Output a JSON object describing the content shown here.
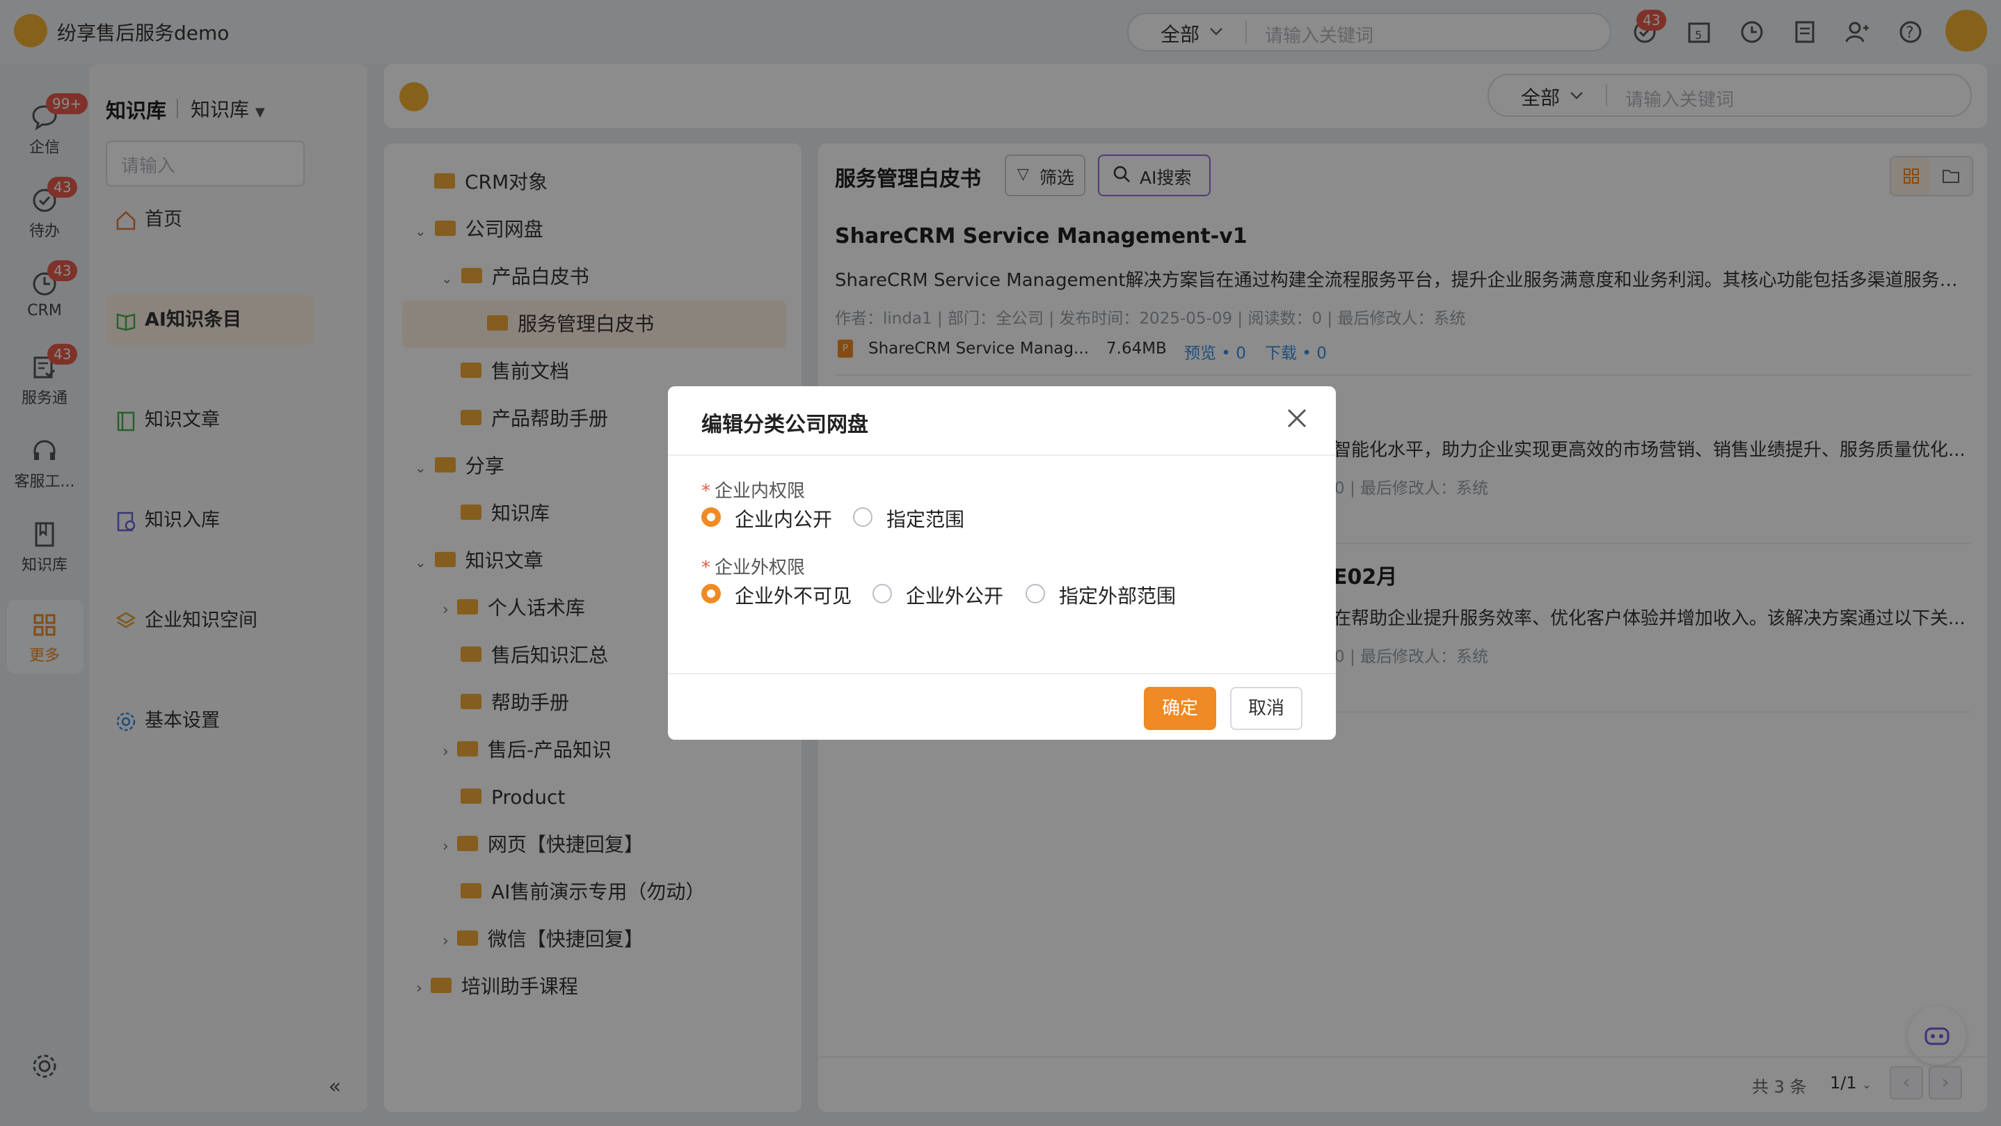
{
  "app": {
    "title": "纷享售后服务demo"
  },
  "topbar": {
    "scope": "全部",
    "search_placeholder": "请输入关键词",
    "notify_badge": "43"
  },
  "rail": [
    {
      "label": "企信",
      "badge": "99+",
      "icon": "chat-icon"
    },
    {
      "label": "待办",
      "badge": "43",
      "icon": "todo-check-icon"
    },
    {
      "label": "CRM",
      "badge": "43",
      "icon": "crm-icon"
    },
    {
      "label": "服务通",
      "badge": "43",
      "icon": "service-icon"
    },
    {
      "label": "客服工...",
      "badge": "",
      "icon": "headset-icon"
    },
    {
      "label": "知识库",
      "badge": "",
      "icon": "book-icon"
    },
    {
      "label": "更多",
      "badge": "",
      "icon": "grid-icon"
    }
  ],
  "nav": {
    "title": "知识库",
    "subtitle": "知识库",
    "search_placeholder": "请输入",
    "items": [
      {
        "label": "首页",
        "icon": "home-icon"
      },
      {
        "label": "AI知识条目",
        "icon": "open-book-icon"
      },
      {
        "label": "知识文章",
        "icon": "article-icon"
      },
      {
        "label": "知识入库",
        "icon": "import-icon"
      },
      {
        "label": "企业知识空间",
        "icon": "layers-icon"
      },
      {
        "label": "基本设置",
        "icon": "settings-icon"
      }
    ]
  },
  "header": {
    "scope": "全部",
    "search_placeholder": "请输入关键词"
  },
  "tree": [
    {
      "label": "CRM对象"
    },
    {
      "label": "公司网盘"
    },
    {
      "label": "产品白皮书"
    },
    {
      "label": "服务管理白皮书"
    },
    {
      "label": "售前文档"
    },
    {
      "label": "产品帮助手册"
    },
    {
      "label": "分享"
    },
    {
      "label": "知识库"
    },
    {
      "label": "知识文章"
    },
    {
      "label": "个人话术库"
    },
    {
      "label": "售后知识汇总"
    },
    {
      "label": "帮助手册"
    },
    {
      "label": "售后-产品知识"
    },
    {
      "label": "Product"
    },
    {
      "label": "网页【快捷回复】"
    },
    {
      "label": "AI售前演示专用（勿动）"
    },
    {
      "label": "微信【快捷回复】"
    },
    {
      "label": "培训助手课程"
    }
  ],
  "content": {
    "title": "服务管理白皮书",
    "filter_label": "筛选",
    "ai_search_label": "AI搜索",
    "docs": [
      {
        "title": "ShareCRM Service Management-v1",
        "desc": "ShareCRM Service Management解决方案旨在通过构建全流程服务平台，提升企业服务满意度和业务利润。其核心功能包括多渠道服务受理...",
        "meta": "作者：linda1  |  部门：全公司  |  发布时间：2025-05-09  |  阅读数：0  |  最后修改人：系统",
        "file_name": "ShareCRM Service Manag...",
        "file_size": "7.64MB",
        "preview": "预览 • 0",
        "download": "下载 • 0"
      },
      {
        "title_tail": "",
        "desc_tail": "智能化水平，助力企业实现更高效的市场营销、销售业绩提升、服务质量优化...",
        "meta_tail": "0  |  最后修改人：系统"
      },
      {
        "title_tail": "E02月",
        "desc_tail": "在帮助企业提升服务效率、优化客户体验并增加收入。该解决方案通过以下关...",
        "meta_tail": "0  |  最后修改人：系统"
      }
    ],
    "total": "共 3 条",
    "page": "1/1"
  },
  "dialog": {
    "title": "编辑分类公司网盘",
    "internal_label": "企业内权限",
    "internal_options": [
      "企业内公开",
      "指定范围"
    ],
    "internal_selected": 0,
    "external_label": "企业外权限",
    "external_options": [
      "企业外不可见",
      "企业外公开",
      "指定外部范围"
    ],
    "external_selected": 0,
    "ok": "确定",
    "cancel": "取消"
  },
  "colors": {
    "accent": "#f08a24",
    "badge": "#e55b4b",
    "folder": "#f0a93a"
  }
}
